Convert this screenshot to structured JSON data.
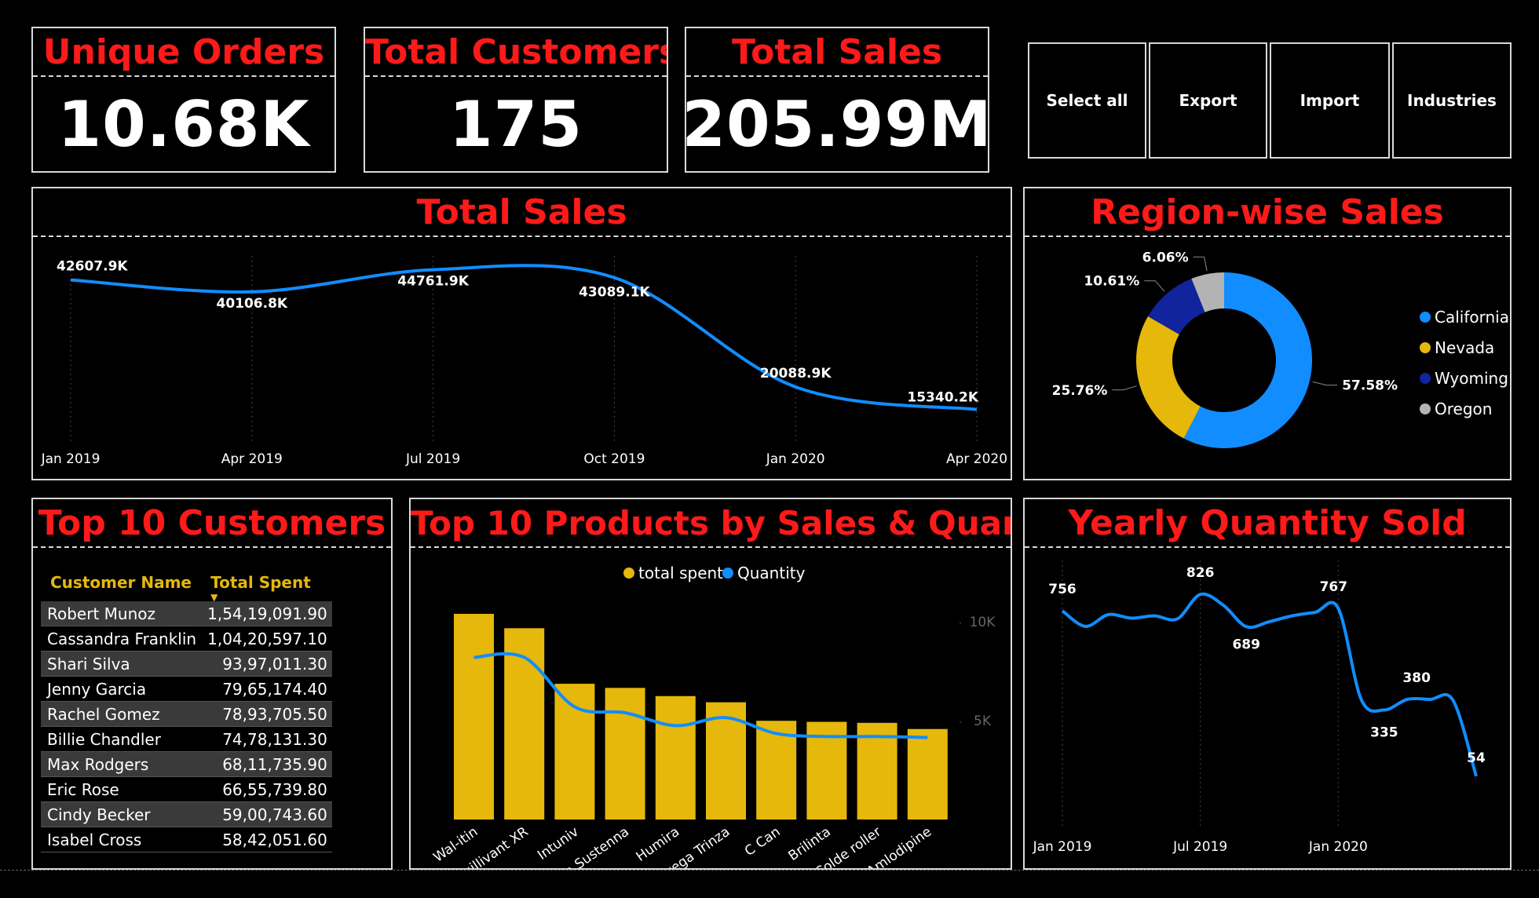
{
  "kpis": {
    "unique_orders": {
      "label": "Unique Orders",
      "value": "10.68K"
    },
    "total_customers": {
      "label": "Total Customers",
      "value": "175"
    },
    "total_sales": {
      "label": "Total Sales",
      "value": "205.99M"
    }
  },
  "buttons": {
    "select_all": "Select all",
    "export": "Export",
    "import": "Import",
    "industries": "Industries"
  },
  "titles": {
    "sales_trend": "Total Sales",
    "region": "Region-wise Sales",
    "customers": "Top 10 Customers",
    "products": "Top 10 Products by Sales & Quantity",
    "yearly": "Yearly Quantity Sold"
  },
  "customers_table": {
    "headers": [
      "Customer Name",
      "Total Spent"
    ],
    "rows": [
      [
        "Robert Munoz",
        "1,54,19,091.90"
      ],
      [
        "Cassandra Franklin",
        "1,04,20,597.10"
      ],
      [
        "Shari Silva",
        "93,97,011.30"
      ],
      [
        "Jenny Garcia",
        "79,65,174.40"
      ],
      [
        "Rachel Gomez",
        "78,93,705.50"
      ],
      [
        "Billie Chandler",
        "74,78,131.30"
      ],
      [
        "Max Rodgers",
        "68,11,735.90"
      ],
      [
        "Eric Rose",
        "66,55,739.80"
      ],
      [
        "Cindy Becker",
        "59,00,743.60"
      ],
      [
        "Isabel Cross",
        "58,42,051.60"
      ]
    ]
  },
  "colors": {
    "title_red": "#ff1a1a",
    "blue": "#118dff",
    "gold": "#e5b80b",
    "navy": "#12239e",
    "gray": "#b3b3b3"
  },
  "chart_data": [
    {
      "type": "line",
      "title": "Total Sales",
      "x": [
        "Jan 2019",
        "Apr 2019",
        "Jul 2019",
        "Oct 2019",
        "Jan 2020",
        "Apr 2020"
      ],
      "values": [
        42607.9,
        40106.8,
        44761.9,
        43089.1,
        20088.9,
        15340.2
      ],
      "labels": [
        "42607.9K",
        "40106.8K",
        "44761.9K",
        "43089.1K",
        "20088.9K",
        "15340.2K"
      ],
      "ylim": [
        10000,
        48000
      ],
      "grid": "vertical dotted"
    },
    {
      "type": "pie",
      "title": "Region-wise Sales",
      "categories": [
        "California",
        "Nevada",
        "Wyoming",
        "Oregon"
      ],
      "values": [
        57.58,
        25.76,
        10.61,
        6.06
      ],
      "labels": [
        "57.58%",
        "25.76%",
        "10.61%",
        "6.06%"
      ],
      "colors": [
        "#118dff",
        "#e5b80b",
        "#12239e",
        "#b3b3b3"
      ],
      "legend": "right"
    },
    {
      "type": "bar",
      "title": "Top 10 Products by Sales & Quantity",
      "categories": [
        "Wal-itin",
        "Quillivant XR",
        "Intuniv",
        "Invega Sustenna",
        "Humira",
        "Invega Trinza",
        "C Can",
        "Brilinta",
        "Colde roller",
        "Amlodipine"
      ],
      "series": [
        {
          "name": "total spent",
          "type": "bar",
          "values": [
            100,
            93,
            66,
            64,
            60,
            57,
            48,
            47.5,
            47,
            44
          ],
          "color": "#e5b80b"
        },
        {
          "name": "Quantity",
          "type": "line",
          "values": [
            8200,
            8200,
            5700,
            5400,
            4750,
            5150,
            4350,
            4200,
            4200,
            4150
          ],
          "color": "#118dff"
        }
      ],
      "y2_ticks": [
        "10K",
        "5K"
      ],
      "y2lim": [
        0,
        10800
      ],
      "legend": "top"
    },
    {
      "type": "line",
      "title": "Yearly Quantity Sold",
      "x_ticks": [
        "Jan 2019",
        "Jul 2019",
        "Jan 2020"
      ],
      "values": [
        756,
        690,
        740,
        725,
        735,
        722,
        826,
        780,
        689,
        710,
        735,
        750,
        767,
        380,
        335,
        380,
        380,
        375,
        54
      ],
      "data_labels": {
        "0": "756",
        "6": "826",
        "8": "689",
        "12": "767",
        "14": "335",
        "15": "380",
        "18": "54"
      },
      "ylim": [
        0,
        1000
      ]
    }
  ]
}
